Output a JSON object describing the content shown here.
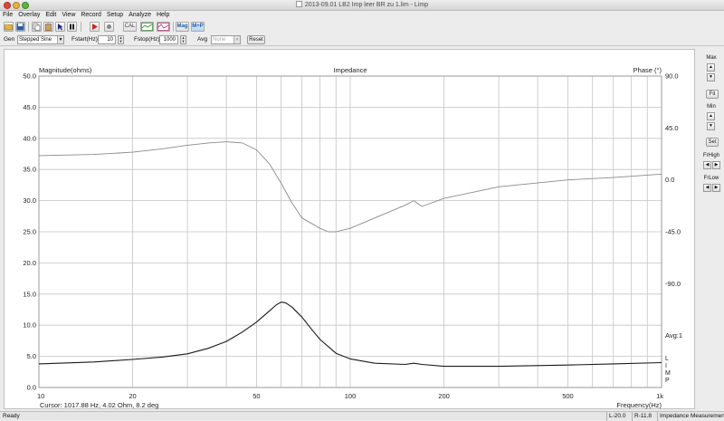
{
  "window": {
    "title": "2013-09.01 LB2 Imp leer BR zu 1.lim - Limp"
  },
  "menu": [
    "File",
    "Overlay",
    "Edit",
    "View",
    "Record",
    "Setup",
    "Analyze",
    "Help"
  ],
  "toolbar": {
    "cal_label": "CAL",
    "mag_label": "Mag",
    "mp_label": "M+P"
  },
  "genbar": {
    "gen_label": "Gen",
    "gen_value": "Stepped Sine",
    "fstart_label": "Fstart(Hz)",
    "fstart_value": "10",
    "fstop_label": "Fstop(Hz)",
    "fstop_value": "1000",
    "avg_label": "Avg",
    "avg_value": "None",
    "reset_label": "Reset"
  },
  "chart_data": {
    "type": "line",
    "title": "Impedance",
    "xlabel": "Frequency(Hz)",
    "ylabel_left": "Magnitude(ohms)",
    "ylabel_right": "Phase (°)",
    "x_scale": "log",
    "xlim": [
      10,
      1000
    ],
    "ylim": [
      0,
      50
    ],
    "phase_lim": [
      -180,
      90
    ],
    "x_ticks": [
      {
        "v": 10,
        "label": "10"
      },
      {
        "v": 20,
        "label": "20"
      },
      {
        "v": 50,
        "label": "50"
      },
      {
        "v": 100,
        "label": "100"
      },
      {
        "v": 200,
        "label": "200"
      },
      {
        "v": 500,
        "label": "500"
      },
      {
        "v": 1000,
        "label": "1k"
      }
    ],
    "y_ticks": [
      "50.0",
      "45.0",
      "40.0",
      "35.0",
      "30.0",
      "25.0",
      "20.0",
      "15.0",
      "10.0",
      "5.0",
      "0.0"
    ],
    "phase_ticks": [
      {
        "v": 90,
        "label": "90.0"
      },
      {
        "v": 45,
        "label": "45.0"
      },
      {
        "v": 0,
        "label": "0.0"
      },
      {
        "v": -45,
        "label": "-45.0"
      },
      {
        "v": -90,
        "label": "-90.0"
      }
    ],
    "avg_label": "Avg:1",
    "side_markers": [
      "L",
      "I",
      "M",
      "P"
    ],
    "series": [
      {
        "role": "magnitude",
        "color": "#1a1a1a",
        "points": [
          [
            10,
            3.8
          ],
          [
            15,
            4.1
          ],
          [
            20,
            4.5
          ],
          [
            25,
            4.9
          ],
          [
            30,
            5.4
          ],
          [
            35,
            6.3
          ],
          [
            40,
            7.4
          ],
          [
            45,
            8.9
          ],
          [
            50,
            10.5
          ],
          [
            55,
            12.3
          ],
          [
            58,
            13.3
          ],
          [
            60,
            13.7
          ],
          [
            62,
            13.6
          ],
          [
            65,
            12.9
          ],
          [
            70,
            11.3
          ],
          [
            75,
            9.4
          ],
          [
            80,
            7.7
          ],
          [
            90,
            5.5
          ],
          [
            100,
            4.6
          ],
          [
            120,
            3.9
          ],
          [
            150,
            3.7
          ],
          [
            160,
            3.9
          ],
          [
            170,
            3.7
          ],
          [
            200,
            3.4
          ],
          [
            300,
            3.4
          ],
          [
            500,
            3.6
          ],
          [
            700,
            3.8
          ],
          [
            1000,
            4.0
          ]
        ]
      },
      {
        "role": "phase",
        "color": "#8a8a8a",
        "points": [
          [
            10,
            21
          ],
          [
            15,
            22
          ],
          [
            20,
            24
          ],
          [
            25,
            27
          ],
          [
            30,
            30
          ],
          [
            35,
            32
          ],
          [
            40,
            33
          ],
          [
            45,
            32
          ],
          [
            50,
            26
          ],
          [
            55,
            14
          ],
          [
            60,
            -3
          ],
          [
            65,
            -20
          ],
          [
            70,
            -33
          ],
          [
            80,
            -42
          ],
          [
            85,
            -45
          ],
          [
            90,
            -45
          ],
          [
            100,
            -42
          ],
          [
            120,
            -33
          ],
          [
            150,
            -22
          ],
          [
            160,
            -18
          ],
          [
            170,
            -23
          ],
          [
            200,
            -16
          ],
          [
            300,
            -6
          ],
          [
            500,
            0
          ],
          [
            700,
            2
          ],
          [
            1000,
            5
          ]
        ]
      }
    ]
  },
  "cursor": {
    "text": "Cursor: 1017.88 Hz, 4.02 Ohm, 8.2 deg"
  },
  "rightpanel": {
    "max_label": "Max",
    "fit_label": "Fit",
    "min_label": "Min",
    "set_label": "Set",
    "frhigh_label": "FrHigh",
    "frlow_label": "FrLow"
  },
  "status": {
    "ready": "Ready",
    "l_value": "L-20.0",
    "r_value": "R-11.8",
    "mode": "Impedance Measuremen"
  }
}
